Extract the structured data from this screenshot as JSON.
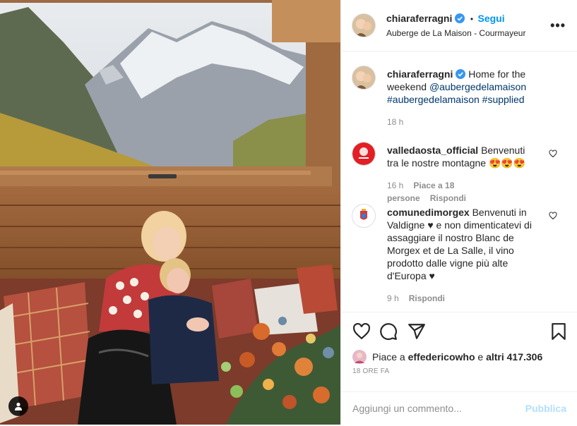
{
  "post": {
    "author": "chiaraferragni",
    "follow_label": "Segui",
    "dot": "•",
    "location": "Auberge de La Maison - Courmayeur",
    "more_label": "•••"
  },
  "caption": {
    "author": "chiaraferragni",
    "text_plain": "Home for the weekend",
    "mention": "@aubergedelamaison",
    "hashtag1": "#aubergedelamaison",
    "hashtag2": "#supplied",
    "time": "18 h"
  },
  "comments": [
    {
      "author": "valledaosta_official",
      "text": "Benvenuti tra le nostre montagne 😍😍😍",
      "time": "16 h",
      "likes": "Piace a 18 persone",
      "reply": "Rispondi"
    },
    {
      "author": "comunedimorgex",
      "text": "Benvenuti in Valdigne ♥ e non dimenticatevi di assaggiare il nostro Blanc de Morgex et de La Salle, il vino prodotto dalle vigne più alte d'Europa ♥",
      "time": "9 h",
      "reply": "Rispondi"
    }
  ],
  "footer": {
    "likes_prefix": "Piace a ",
    "liked_by": "effedericowho",
    "likes_middle": " e ",
    "others": "altri 417.306",
    "time_ago": "18 ORE FA",
    "comment_placeholder": "Aggiungi un commento...",
    "publish_label": "Pubblica"
  },
  "colors": {
    "accent": "#0095f6",
    "verified": "#3897f0",
    "publish_disabled": "#b2dffc",
    "muted": "#8e8e8e"
  },
  "icons": [
    "user-tag-icon",
    "verified-icon",
    "more-options-icon",
    "heart-icon",
    "comment-icon",
    "share-icon",
    "bookmark-icon"
  ]
}
